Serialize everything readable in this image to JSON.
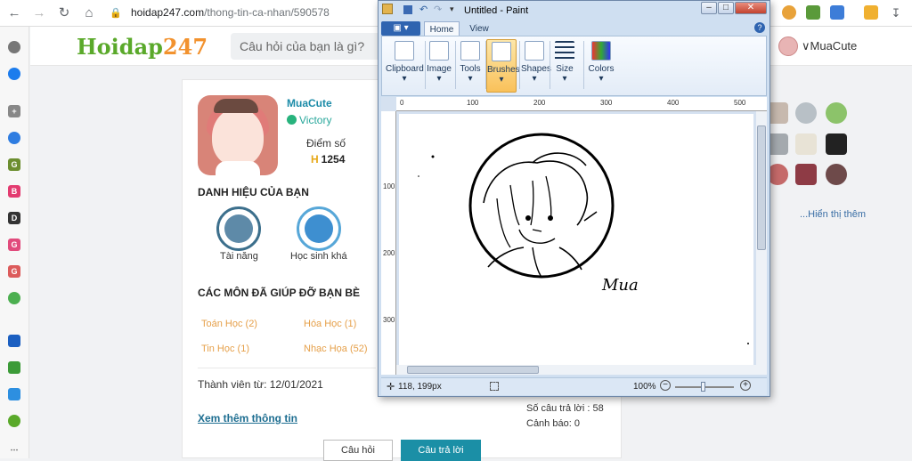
{
  "browser": {
    "url_host": "hoidap247.com",
    "url_path": "/thong-tin-ca-nhan/590578"
  },
  "site": {
    "logo_main": "Hoidap",
    "logo_num": "247",
    "search_placeholder": "Câu hỏi của bạn là gì?",
    "user_name": "MuaCute"
  },
  "profile": {
    "name": "MuaCute",
    "rank": "Victory",
    "score_label": "Điểm số",
    "score_value": "1254",
    "badges_title": "DANH HIỆU CỦA BẠN",
    "badges": [
      {
        "label": "Tài năng",
        "icon": "wheat-icon"
      },
      {
        "label": "Học sinh khá",
        "icon": "star-badge-icon"
      }
    ],
    "subjects_title": "CÁC MÔN ĐÃ GIÚP ĐỠ BẠN BÈ",
    "subjects": [
      "Toán Học (2)",
      "Hóa Học (1)",
      "Tin Học (1)",
      "Nhạc Họa (52)"
    ],
    "member_since": "Thành viên từ: 12/01/2021",
    "more_info": "Xem thêm thông tin",
    "answers_count": "Số câu trả lời : 58",
    "warnings": "Cảnh báo: 0",
    "btn_questions": "Câu hỏi",
    "btn_answers": "Câu trả lời"
  },
  "sidebar": {
    "show_more": "...Hiển thị thêm"
  },
  "paint": {
    "title": "Untitled - Paint",
    "tabs": [
      "Home",
      "View"
    ],
    "groups": [
      "Clipboard",
      "Image",
      "Tools",
      "Brushes",
      "Shapes",
      "Size",
      "Colors"
    ],
    "ruler_h": [
      "0",
      "100",
      "200",
      "300",
      "400",
      "500"
    ],
    "ruler_v": [
      "100",
      "200",
      "300"
    ],
    "coords": "118, 199px",
    "zoom": "100%",
    "signature": "Mua"
  },
  "colors": {
    "brand_green": "#5aa92a",
    "brand_orange": "#f2922e",
    "accent_blue": "#1b8fa6"
  }
}
